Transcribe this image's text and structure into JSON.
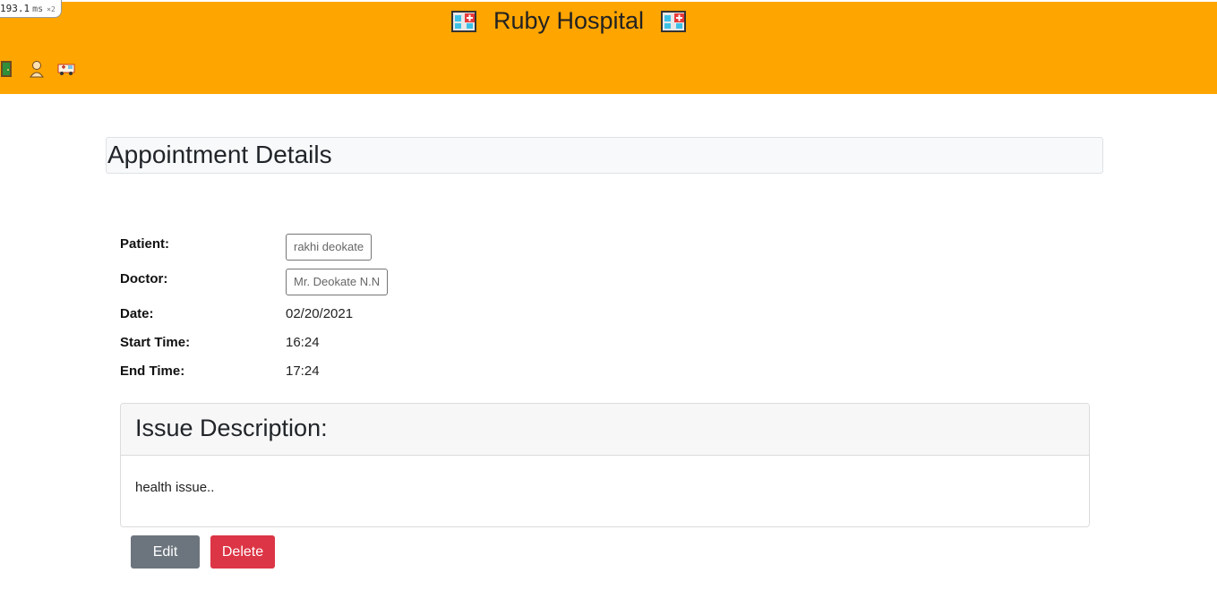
{
  "perf_badge": {
    "value": "193.1",
    "unit": "ms",
    "multiplier": "×2"
  },
  "header": {
    "title": "Ruby Hospital",
    "brand_icon": "hospital-icon",
    "nav_icons": [
      "door-icon",
      "person-icon",
      "ambulance-icon"
    ],
    "background": "#ffa500"
  },
  "page": {
    "title": "Appointment Details"
  },
  "details": {
    "patient_label": "Patient:",
    "patient_value": "rakhi deokate",
    "doctor_label": "Doctor:",
    "doctor_value": "Mr. Deokate N.N",
    "date_label": "Date:",
    "date_value": "02/20/2021",
    "start_label": "Start Time:",
    "start_value": "16:24",
    "end_label": "End Time:",
    "end_value": "17:24"
  },
  "issue": {
    "title": "Issue Description:",
    "text": "health issue.."
  },
  "actions": {
    "edit_label": "Edit",
    "delete_label": "Delete",
    "edit_color": "#6c757d",
    "delete_color": "#dc3545"
  }
}
